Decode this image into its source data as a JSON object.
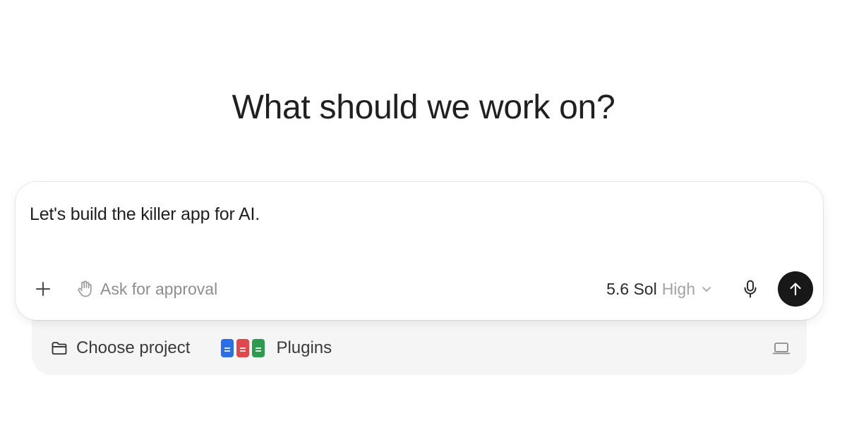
{
  "page": {
    "headline": "What should we work on?"
  },
  "composer": {
    "prompt_text": "Let's build the killer app for AI.",
    "add_icon": "plus-icon",
    "approval_icon": "hand-icon",
    "approval_label": "Ask for approval",
    "model_name": "5.6 Sol",
    "model_level": "High",
    "model_chevron_icon": "chevron-down-icon",
    "mic_icon": "microphone-icon",
    "send_icon": "arrow-up-icon"
  },
  "project_bar": {
    "choose_project_icon": "folder-icon",
    "choose_project_label": "Choose project",
    "plugins_icons": [
      "docs-icon",
      "pdf-icon",
      "sheets-icon"
    ],
    "plugins_label": "Plugins",
    "environment_icon": "laptop-icon"
  },
  "colors": {
    "background": "#ffffff",
    "tray": "#f5f5f5",
    "send_button": "#181818",
    "muted_text": "#8e8e8e",
    "docs_blue": "#2a6fe6",
    "pdf_red": "#e2474b",
    "sheets_green": "#2d9a4f"
  }
}
